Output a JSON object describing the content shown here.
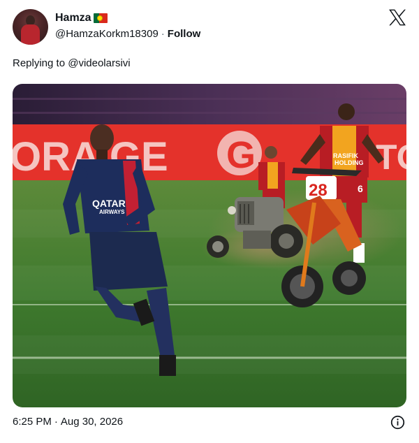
{
  "tweet": {
    "display_name": "Hamza",
    "flag_icon": "portugal-flag-icon",
    "handle": "@HamzaKorkm18309",
    "separator": "·",
    "follow_label": "Follow",
    "reply_prefix": "Replying to",
    "reply_to": "@videolarsivi",
    "time": "6:25 PM",
    "date": "Aug 30, 2026"
  },
  "media": {
    "banner_left_text": "ORA GE",
    "banner_right_text": "TO",
    "jersey_sponsor_line1": "QATAR",
    "jersey_sponsor_line2": "AIRWAYS",
    "galatasaray_sponsor_line1": "RASIFIK",
    "galatasaray_sponsor_line2": "HOLDING",
    "motorbike_number": "28",
    "rider_number": "6"
  },
  "icons": {
    "x_logo": "x-logo-icon",
    "info": "info-icon"
  },
  "colors": {
    "psg_navy": "#1d2d5c",
    "gala_red": "#b81d24",
    "gala_yellow": "#f2a41f",
    "pitch_green": "#3f7a2e",
    "banner_red": "#e4322b"
  }
}
